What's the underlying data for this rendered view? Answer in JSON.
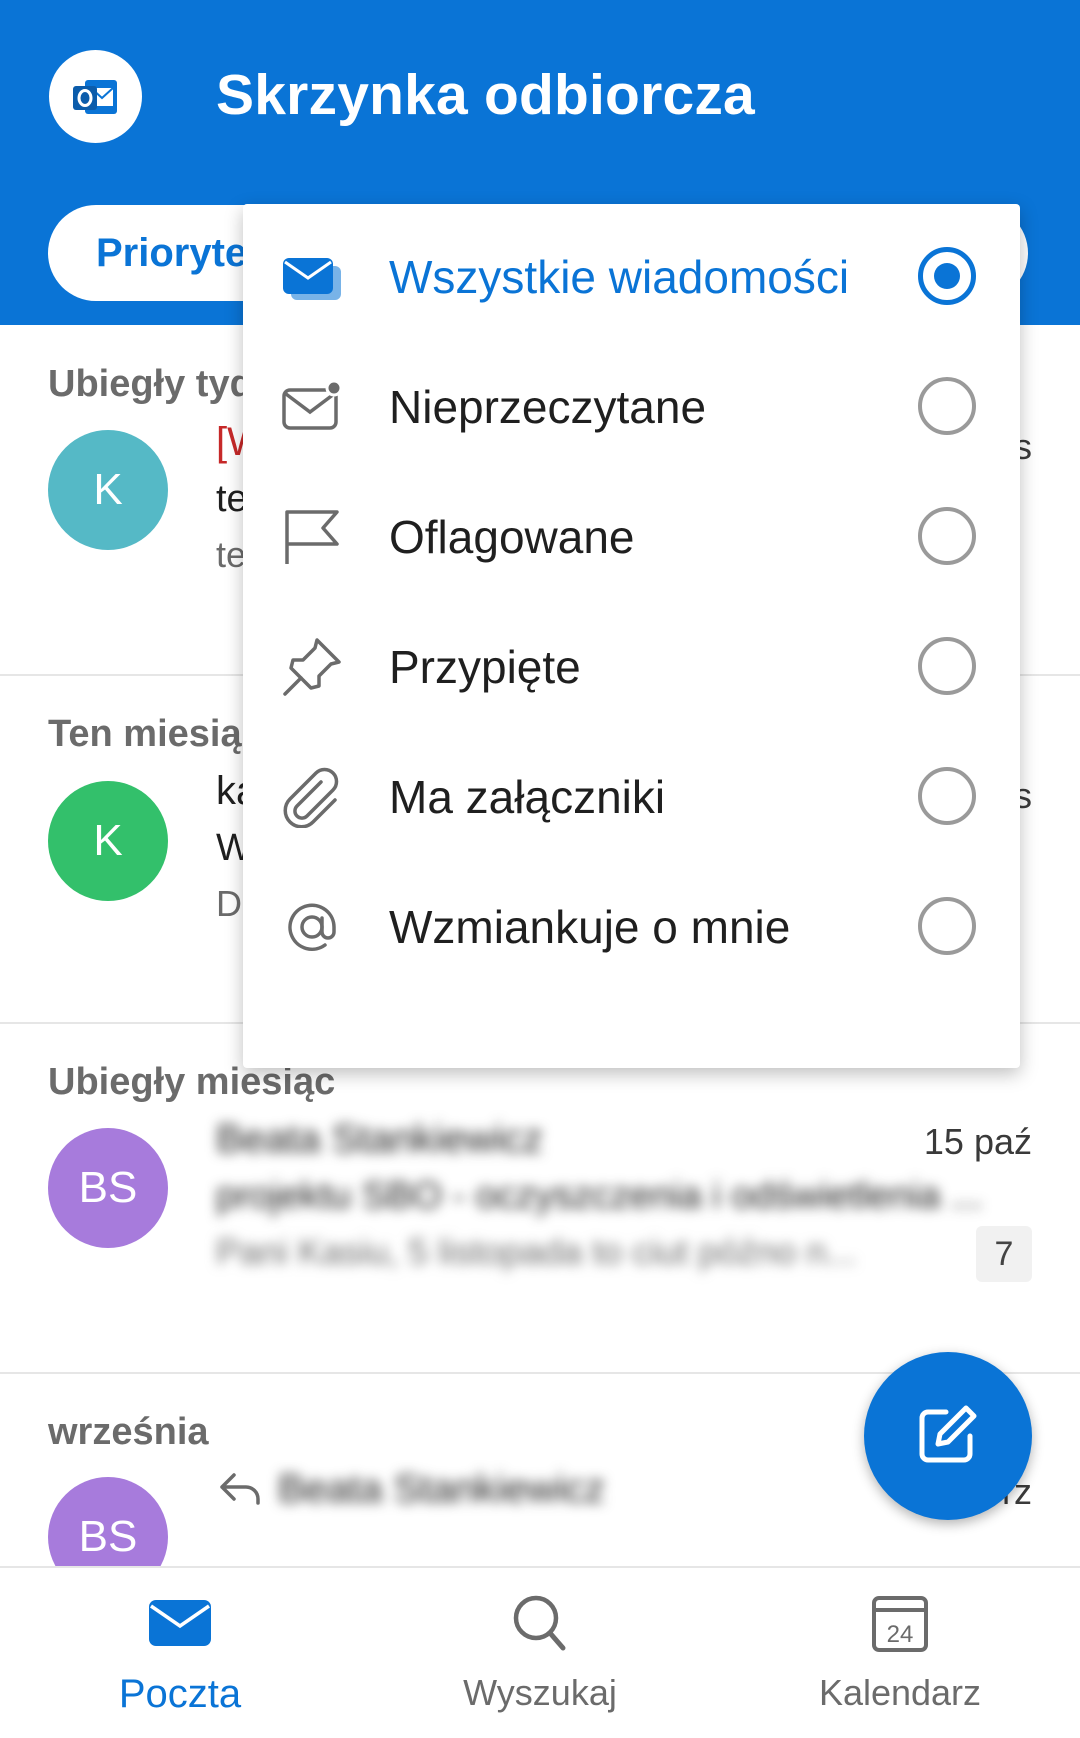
{
  "header": {
    "title": "Skrzynka odbiorcza",
    "logo_icon": "outlook-logo-icon",
    "filter_label": "Priorytet",
    "background_color": "#0a74d6"
  },
  "sections": [
    {
      "title": "Ubiegły tydzień",
      "items": [
        {
          "avatar": "K",
          "avatar_color": "#55b9c6",
          "sender": "[W",
          "subject": "te",
          "preview": "te",
          "date": "s"
        }
      ]
    },
    {
      "title": "Ten miesiąc",
      "items": [
        {
          "avatar": "K",
          "avatar_color": "#33c06b",
          "sender": "ka",
          "subject": "W",
          "preview": "D",
          "date": "s"
        }
      ]
    },
    {
      "title": "Ubiegły miesiąc",
      "items": [
        {
          "avatar": "BS",
          "avatar_color": "#a77bdc",
          "sender": "Beata Stankiewicz",
          "subject": "projektu SBO - oczyszczenia i odświetlenia ...",
          "preview": "Pani Kasiu, 5 listopada to ciut późno n...",
          "date": "15 paź",
          "count": "7"
        }
      ]
    },
    {
      "title": "września",
      "items": [
        {
          "avatar": "BS",
          "avatar_color": "#a77bdc",
          "sender": "Beata Stankiewicz",
          "date": "15 wrz"
        }
      ]
    }
  ],
  "filter_menu": {
    "items": [
      {
        "label": "Wszystkie wiadomości",
        "icon": "envelope-stack-icon",
        "selected": true
      },
      {
        "label": "Nieprzeczytane",
        "icon": "unread-envelope-icon",
        "selected": false
      },
      {
        "label": "Oflagowane",
        "icon": "flag-icon",
        "selected": false
      },
      {
        "label": "Przypięte",
        "icon": "pin-icon",
        "selected": false
      },
      {
        "label": "Ma załączniki",
        "icon": "paperclip-icon",
        "selected": false
      },
      {
        "label": "Wzmiankuje o mnie",
        "icon": "at-sign-icon",
        "selected": false
      }
    ]
  },
  "fab": {
    "icon": "compose-icon"
  },
  "bottom_nav": {
    "items": [
      {
        "label": "Poczta",
        "icon": "mail-icon",
        "active": true
      },
      {
        "label": "Wyszukaj",
        "icon": "search-icon",
        "active": false
      },
      {
        "label": "Kalendarz",
        "icon": "calendar-icon",
        "calendar_day": "24",
        "active": false
      }
    ]
  },
  "colors": {
    "accent": "#0a74d6",
    "divider": "#e6e6e6"
  }
}
